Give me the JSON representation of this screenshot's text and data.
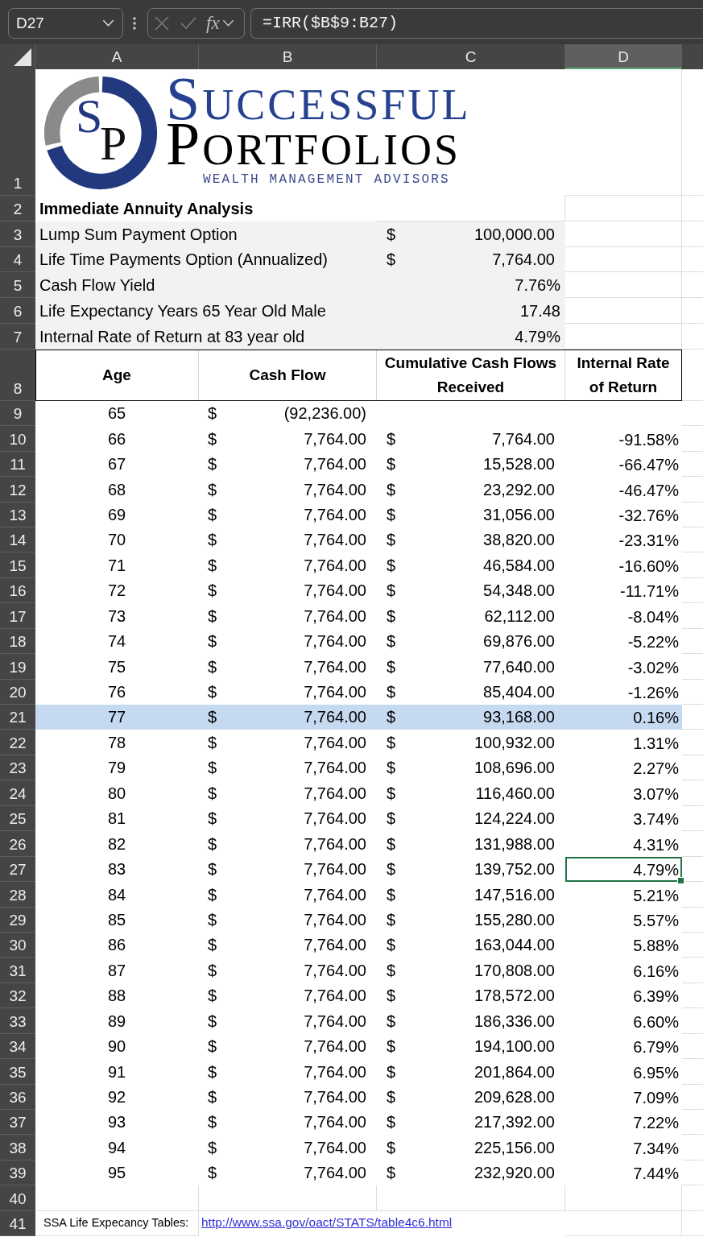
{
  "formula_bar": {
    "name_box": "D27",
    "editing": false,
    "function_label": "fx",
    "formula": "=IRR($B$9:B27)"
  },
  "column_headers": [
    {
      "label": "A",
      "selected": false
    },
    {
      "label": "B",
      "selected": false
    },
    {
      "label": "C",
      "selected": false
    },
    {
      "label": "D",
      "selected": true
    }
  ],
  "logo": {
    "row": "1",
    "monogram": [
      {
        "letter": "S",
        "color": "#23397f"
      },
      {
        "letter": "P",
        "color": "#111111"
      }
    ],
    "title_lines": [
      {
        "text": "SUCCESSFUL",
        "color": "#26418f"
      },
      {
        "text": "PORTFOLIOS",
        "color": "#000000"
      }
    ],
    "tagline": "WEALTH MANAGEMENT ADVISORS"
  },
  "title_row": {
    "row": "2",
    "text": "Immediate Annuity Analysis"
  },
  "summary_rows": [
    {
      "row": "3",
      "kind": "currency",
      "label": "Lump Sum Payment Option",
      "symbol": "$",
      "value": "100,000.00"
    },
    {
      "row": "4",
      "kind": "currency",
      "label": "Life Time Payments Option (Annualized)",
      "symbol": "$",
      "value": "7,764.00"
    },
    {
      "row": "5",
      "kind": "number",
      "label": "Cash Flow Yield",
      "value": "7.76%"
    },
    {
      "row": "6",
      "kind": "number",
      "label": "Life Expectancy Years 65 Year Old Male",
      "value": "17.48"
    },
    {
      "row": "7",
      "kind": "number",
      "label": "Internal Rate of Return at 83 year old",
      "value": "4.79%"
    }
  ],
  "header_row": {
    "row": "8",
    "columns": [
      "Age",
      "Cash Flow",
      "Cumulative Cash Flows Received",
      "Internal Rate of Return"
    ]
  },
  "data_rows": [
    {
      "row": "9",
      "age": "65",
      "cash_flow": {
        "symbol": "$",
        "amount": "(92,236.00)"
      },
      "irr": {
        "selected": false
      },
      "highlighted": false
    },
    {
      "row": "10",
      "age": "66",
      "cash_flow": {
        "symbol": "$",
        "amount": "7,764.00"
      },
      "cumulative": {
        "symbol": "$",
        "amount": "7,764.00"
      },
      "irr": {
        "text": "-91.58%",
        "selected": false
      },
      "highlighted": false
    },
    {
      "row": "11",
      "age": "67",
      "cash_flow": {
        "symbol": "$",
        "amount": "7,764.00"
      },
      "cumulative": {
        "symbol": "$",
        "amount": "15,528.00"
      },
      "irr": {
        "text": "-66.47%",
        "selected": false
      },
      "highlighted": false
    },
    {
      "row": "12",
      "age": "68",
      "cash_flow": {
        "symbol": "$",
        "amount": "7,764.00"
      },
      "cumulative": {
        "symbol": "$",
        "amount": "23,292.00"
      },
      "irr": {
        "text": "-46.47%",
        "selected": false
      },
      "highlighted": false
    },
    {
      "row": "13",
      "age": "69",
      "cash_flow": {
        "symbol": "$",
        "amount": "7,764.00"
      },
      "cumulative": {
        "symbol": "$",
        "amount": "31,056.00"
      },
      "irr": {
        "text": "-32.76%",
        "selected": false
      },
      "highlighted": false
    },
    {
      "row": "14",
      "age": "70",
      "cash_flow": {
        "symbol": "$",
        "amount": "7,764.00"
      },
      "cumulative": {
        "symbol": "$",
        "amount": "38,820.00"
      },
      "irr": {
        "text": "-23.31%",
        "selected": false
      },
      "highlighted": false
    },
    {
      "row": "15",
      "age": "71",
      "cash_flow": {
        "symbol": "$",
        "amount": "7,764.00"
      },
      "cumulative": {
        "symbol": "$",
        "amount": "46,584.00"
      },
      "irr": {
        "text": "-16.60%",
        "selected": false
      },
      "highlighted": false
    },
    {
      "row": "16",
      "age": "72",
      "cash_flow": {
        "symbol": "$",
        "amount": "7,764.00"
      },
      "cumulative": {
        "symbol": "$",
        "amount": "54,348.00"
      },
      "irr": {
        "text": "-11.71%",
        "selected": false
      },
      "highlighted": false
    },
    {
      "row": "17",
      "age": "73",
      "cash_flow": {
        "symbol": "$",
        "amount": "7,764.00"
      },
      "cumulative": {
        "symbol": "$",
        "amount": "62,112.00"
      },
      "irr": {
        "text": "-8.04%",
        "selected": false
      },
      "highlighted": false
    },
    {
      "row": "18",
      "age": "74",
      "cash_flow": {
        "symbol": "$",
        "amount": "7,764.00"
      },
      "cumulative": {
        "symbol": "$",
        "amount": "69,876.00"
      },
      "irr": {
        "text": "-5.22%",
        "selected": false
      },
      "highlighted": false
    },
    {
      "row": "19",
      "age": "75",
      "cash_flow": {
        "symbol": "$",
        "amount": "7,764.00"
      },
      "cumulative": {
        "symbol": "$",
        "amount": "77,640.00"
      },
      "irr": {
        "text": "-3.02%",
        "selected": false
      },
      "highlighted": false
    },
    {
      "row": "20",
      "age": "76",
      "cash_flow": {
        "symbol": "$",
        "amount": "7,764.00"
      },
      "cumulative": {
        "symbol": "$",
        "amount": "85,404.00"
      },
      "irr": {
        "text": "-1.26%",
        "selected": false
      },
      "highlighted": false
    },
    {
      "row": "21",
      "age": "77",
      "cash_flow": {
        "symbol": "$",
        "amount": "7,764.00"
      },
      "cumulative": {
        "symbol": "$",
        "amount": "93,168.00"
      },
      "irr": {
        "text": "0.16%",
        "selected": false
      },
      "highlighted": true
    },
    {
      "row": "22",
      "age": "78",
      "cash_flow": {
        "symbol": "$",
        "amount": "7,764.00"
      },
      "cumulative": {
        "symbol": "$",
        "amount": "100,932.00"
      },
      "irr": {
        "text": "1.31%",
        "selected": false
      },
      "highlighted": false
    },
    {
      "row": "23",
      "age": "79",
      "cash_flow": {
        "symbol": "$",
        "amount": "7,764.00"
      },
      "cumulative": {
        "symbol": "$",
        "amount": "108,696.00"
      },
      "irr": {
        "text": "2.27%",
        "selected": false
      },
      "highlighted": false
    },
    {
      "row": "24",
      "age": "80",
      "cash_flow": {
        "symbol": "$",
        "amount": "7,764.00"
      },
      "cumulative": {
        "symbol": "$",
        "amount": "116,460.00"
      },
      "irr": {
        "text": "3.07%",
        "selected": false
      },
      "highlighted": false
    },
    {
      "row": "25",
      "age": "81",
      "cash_flow": {
        "symbol": "$",
        "amount": "7,764.00"
      },
      "cumulative": {
        "symbol": "$",
        "amount": "124,224.00"
      },
      "irr": {
        "text": "3.74%",
        "selected": false
      },
      "highlighted": false
    },
    {
      "row": "26",
      "age": "82",
      "cash_flow": {
        "symbol": "$",
        "amount": "7,764.00"
      },
      "cumulative": {
        "symbol": "$",
        "amount": "131,988.00"
      },
      "irr": {
        "text": "4.31%",
        "selected": false
      },
      "highlighted": false
    },
    {
      "row": "27",
      "age": "83",
      "cash_flow": {
        "symbol": "$",
        "amount": "7,764.00"
      },
      "cumulative": {
        "symbol": "$",
        "amount": "139,752.00"
      },
      "irr": {
        "text": "4.79%",
        "selected": true
      },
      "highlighted": false
    },
    {
      "row": "28",
      "age": "84",
      "cash_flow": {
        "symbol": "$",
        "amount": "7,764.00"
      },
      "cumulative": {
        "symbol": "$",
        "amount": "147,516.00"
      },
      "irr": {
        "text": "5.21%",
        "selected": false
      },
      "highlighted": false
    },
    {
      "row": "29",
      "age": "85",
      "cash_flow": {
        "symbol": "$",
        "amount": "7,764.00"
      },
      "cumulative": {
        "symbol": "$",
        "amount": "155,280.00"
      },
      "irr": {
        "text": "5.57%",
        "selected": false
      },
      "highlighted": false
    },
    {
      "row": "30",
      "age": "86",
      "cash_flow": {
        "symbol": "$",
        "amount": "7,764.00"
      },
      "cumulative": {
        "symbol": "$",
        "amount": "163,044.00"
      },
      "irr": {
        "text": "5.88%",
        "selected": false
      },
      "highlighted": false
    },
    {
      "row": "31",
      "age": "87",
      "cash_flow": {
        "symbol": "$",
        "amount": "7,764.00"
      },
      "cumulative": {
        "symbol": "$",
        "amount": "170,808.00"
      },
      "irr": {
        "text": "6.16%",
        "selected": false
      },
      "highlighted": false
    },
    {
      "row": "32",
      "age": "88",
      "cash_flow": {
        "symbol": "$",
        "amount": "7,764.00"
      },
      "cumulative": {
        "symbol": "$",
        "amount": "178,572.00"
      },
      "irr": {
        "text": "6.39%",
        "selected": false
      },
      "highlighted": false
    },
    {
      "row": "33",
      "age": "89",
      "cash_flow": {
        "symbol": "$",
        "amount": "7,764.00"
      },
      "cumulative": {
        "symbol": "$",
        "amount": "186,336.00"
      },
      "irr": {
        "text": "6.60%",
        "selected": false
      },
      "highlighted": false
    },
    {
      "row": "34",
      "age": "90",
      "cash_flow": {
        "symbol": "$",
        "amount": "7,764.00"
      },
      "cumulative": {
        "symbol": "$",
        "amount": "194,100.00"
      },
      "irr": {
        "text": "6.79%",
        "selected": false
      },
      "highlighted": false
    },
    {
      "row": "35",
      "age": "91",
      "cash_flow": {
        "symbol": "$",
        "amount": "7,764.00"
      },
      "cumulative": {
        "symbol": "$",
        "amount": "201,864.00"
      },
      "irr": {
        "text": "6.95%",
        "selected": false
      },
      "highlighted": false
    },
    {
      "row": "36",
      "age": "92",
      "cash_flow": {
        "symbol": "$",
        "amount": "7,764.00"
      },
      "cumulative": {
        "symbol": "$",
        "amount": "209,628.00"
      },
      "irr": {
        "text": "7.09%",
        "selected": false
      },
      "highlighted": false
    },
    {
      "row": "37",
      "age": "93",
      "cash_flow": {
        "symbol": "$",
        "amount": "7,764.00"
      },
      "cumulative": {
        "symbol": "$",
        "amount": "217,392.00"
      },
      "irr": {
        "text": "7.22%",
        "selected": false
      },
      "highlighted": false
    },
    {
      "row": "38",
      "age": "94",
      "cash_flow": {
        "symbol": "$",
        "amount": "7,764.00"
      },
      "cumulative": {
        "symbol": "$",
        "amount": "225,156.00"
      },
      "irr": {
        "text": "7.34%",
        "selected": false
      },
      "highlighted": false
    },
    {
      "row": "39",
      "age": "95",
      "cash_flow": {
        "symbol": "$",
        "amount": "7,764.00"
      },
      "cumulative": {
        "symbol": "$",
        "amount": "232,920.00"
      },
      "irr": {
        "text": "7.44%",
        "selected": false
      },
      "highlighted": false
    }
  ],
  "empty_row": {
    "row": "40"
  },
  "footer_row": {
    "row": "41",
    "label": "SSA Life Expecancy Tables:",
    "link": "http://www.ssa.gov/oact/STATS/table4c6.html"
  }
}
